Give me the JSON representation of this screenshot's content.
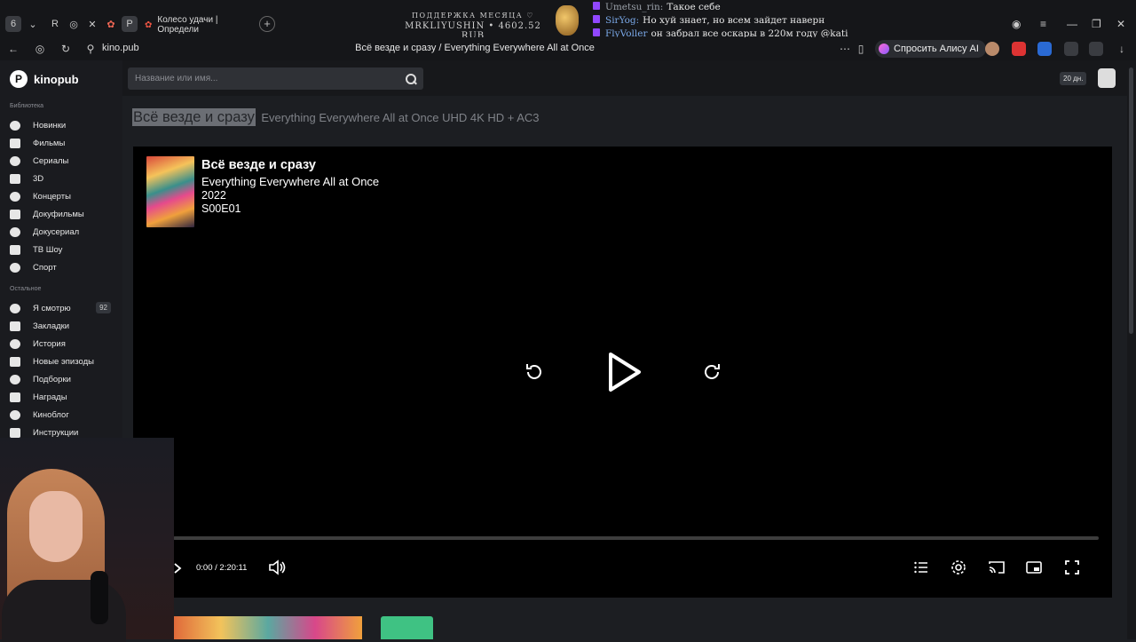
{
  "browser": {
    "tab_title": "Колесо удачи | Определи",
    "url": "kino.pub",
    "page_title": "Всё везде и сразу / Everything Everywhere All at Once",
    "alice_label": "Спросить Алису AI"
  },
  "overlay": {
    "support_line1": "ПОДДЕРЖКА МЕСЯЦА ♡",
    "support_line2": "MRKLIYUSHIN • 4602.52 RUB",
    "chat": [
      {
        "nick": "Umetsu_rin:",
        "nick_color": "#9aa0a8",
        "text": "Такое себе"
      },
      {
        "nick": "SirYog:",
        "nick_color": "#7aa8e8",
        "text": "Но хуй знает, но всем зайдет наверн"
      },
      {
        "nick": "FlyVoller",
        "nick_color": "#7aa8e8",
        "text": "он забрал все оскары в 220м году @kati"
      }
    ]
  },
  "site": {
    "logo": "kinopub",
    "search_placeholder": "Название или имя...",
    "days_badge": "20 дн."
  },
  "sidebar": {
    "section_library": "Библиотека",
    "library": [
      {
        "label": "Новинки",
        "icon": "fire-icon"
      },
      {
        "label": "Фильмы",
        "icon": "film-icon"
      },
      {
        "label": "Сериалы",
        "icon": "tv-icon"
      },
      {
        "label": "3D",
        "icon": "3d-icon"
      },
      {
        "label": "Концерты",
        "icon": "music-icon"
      },
      {
        "label": "Докуфильмы",
        "icon": "doc-film-icon"
      },
      {
        "label": "Докусериал",
        "icon": "doc-series-icon"
      },
      {
        "label": "ТВ Шоу",
        "icon": "tv-show-icon"
      },
      {
        "label": "Спорт",
        "icon": "sport-icon"
      }
    ],
    "section_other": "Остальное",
    "other": [
      {
        "label": "Я смотрю",
        "icon": "watching-icon",
        "count": "92"
      },
      {
        "label": "Закладки",
        "icon": "bookmark-icon"
      },
      {
        "label": "История",
        "icon": "history-icon"
      },
      {
        "label": "Новые эпизоды",
        "icon": "new-episodes-icon"
      },
      {
        "label": "Подборки",
        "icon": "collections-icon"
      },
      {
        "label": "Награды",
        "icon": "trophy-icon"
      },
      {
        "label": "Киноблог",
        "icon": "blog-icon"
      },
      {
        "label": "Инструкции",
        "icon": "instructions-icon"
      }
    ]
  },
  "movie": {
    "title_ru": "Всё везде и сразу",
    "title_en_heading": "Everything Everywhere All at Once UHD 4K HD + AC3",
    "player_title": "Всё везде и сразу",
    "player_subtitle": "Everything Everywhere All at Once",
    "year": "2022",
    "episode": "S00E01",
    "time_current": "0:00",
    "time_separator": "/",
    "time_total": "2:20:11",
    "progress": 0
  }
}
